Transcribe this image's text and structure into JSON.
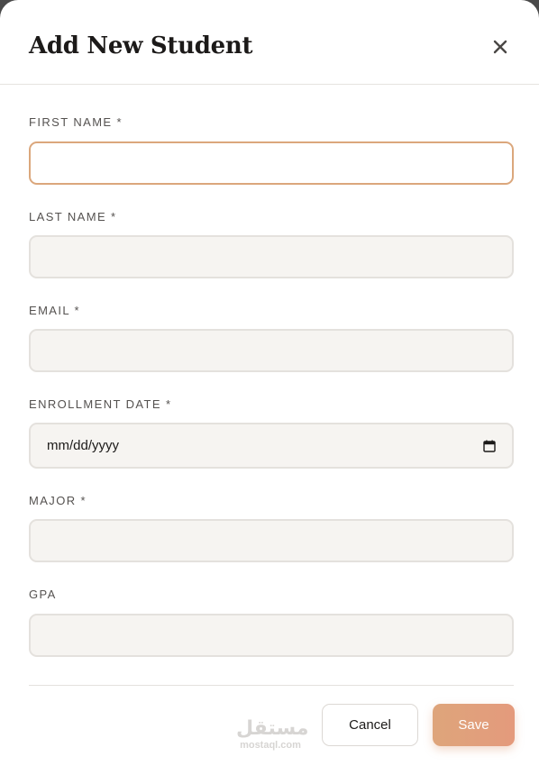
{
  "modal": {
    "title": "Add New Student",
    "close_icon": "close-icon"
  },
  "form": {
    "first_name": {
      "label": "FIRST NAME *",
      "value": ""
    },
    "last_name": {
      "label": "LAST NAME *",
      "value": ""
    },
    "email": {
      "label": "EMAIL *",
      "value": ""
    },
    "enrollment_date": {
      "label": "ENROLLMENT DATE *",
      "placeholder": "mm/dd/yyyy",
      "icon": "calendar-icon"
    },
    "major": {
      "label": "MAJOR *",
      "value": ""
    },
    "gpa": {
      "label": "GPA",
      "value": ""
    }
  },
  "footer": {
    "cancel_label": "Cancel",
    "save_label": "Save"
  },
  "watermark": {
    "arabic": "مستقل",
    "latin": "mostaql.com"
  },
  "colors": {
    "accent": "#dea57b",
    "focus_border": "#dba77c",
    "input_bg": "#f6f4f1",
    "input_border": "#e4e1dd"
  }
}
